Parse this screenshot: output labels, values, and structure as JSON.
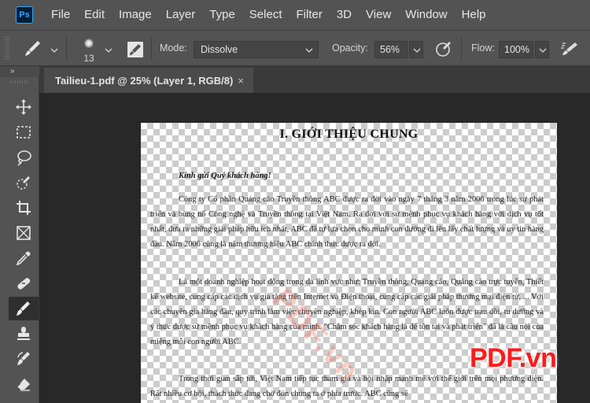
{
  "app": {
    "logo_text": "Ps"
  },
  "menu": [
    "File",
    "Edit",
    "Image",
    "Layer",
    "Type",
    "Select",
    "Filter",
    "3D",
    "View",
    "Window",
    "Help"
  ],
  "options": {
    "brush_size": "13",
    "mode_label": "Mode:",
    "mode_value": "Dissolve",
    "opacity_label": "Opacity:",
    "opacity_value": "56%",
    "flow_label": "Flow:",
    "flow_value": "100%"
  },
  "toolbar": {
    "collapse_glyph": "»",
    "tools": [
      "move-tool",
      "marquee-tool",
      "lasso-tool",
      "quick-selection-tool",
      "crop-tool",
      "frame-tool",
      "eyedropper-tool",
      "healing-brush-tool",
      "brush-tool",
      "clone-stamp-tool",
      "history-brush-tool",
      "eraser-tool"
    ],
    "active_tool": "brush-tool"
  },
  "document_tab": {
    "title": "Tailieu-1.pdf @ 25% (Layer 1, RGB/8)",
    "close_glyph": "×"
  },
  "document": {
    "title": "I. GIỚI THIỆU CHUNG",
    "greeting": "Kính gửi Quý khách hàng!",
    "paragraphs": [
      "Công ty Cổ phần Quảng cáo Truyền thông ABC được ra đời vào ngày 7 tháng 3 năm 2006 trong lúc sự phát triển và bùng nổ Công nghệ và Truyền thông tại Việt Nam. Ra đời với sứ mệnh phục vụ khách hàng với dịch vụ tốt nhất, đưa ra những giải pháp hữu ích nhất, ABC đã tự lựa chọn cho mình con đường đi lên lấy chất lượng và uy tín hàng đầu. Năm 2006 cũng là năm thương hiệu ABC chính thức được ra đời.",
      "Là một doanh nghiệp hoạt động trong đa lĩnh vực như: Truyền thông, Quảng cáo, Quảng cáo trực tuyến, Thiết kế website, cung cấp các dịch vụ gia tăng trên Internet và Điện thoại, cung cấp các giải pháp thương mại điện tử, ... Với các chuyên gia hàng đầu, quy trình làm việc chuyên nghiệp, khép kín. Con người ABC luôn được trau dồi, tu dưỡng và ý thức được sứ mệnh phục vụ khách hàng của mình. \"Chăm sóc khách hàng là để tôn tại và phát triển\" đã là câu nói của miệng mỗi con người ABC.",
      "Trong thời gian sắp tới, Việt Nam tiếp tục tham gia và hội nhập mạnh mẽ với thế giới trên mọi phương diện. Rất nhiều cơ hội, thách thức đang chờ đón chúng ta ở phía trước. ABC cũng sẽ"
    ]
  },
  "watermarks": {
    "diagonal": "PDF.vn",
    "logo": "PDF.vn"
  },
  "colors": {
    "chrome": "#535353",
    "canvas_bg": "#282828",
    "tab_bar": "#3a3a3a",
    "logo_red": "#ff1a1a",
    "ps_blue": "#31a8ff"
  }
}
